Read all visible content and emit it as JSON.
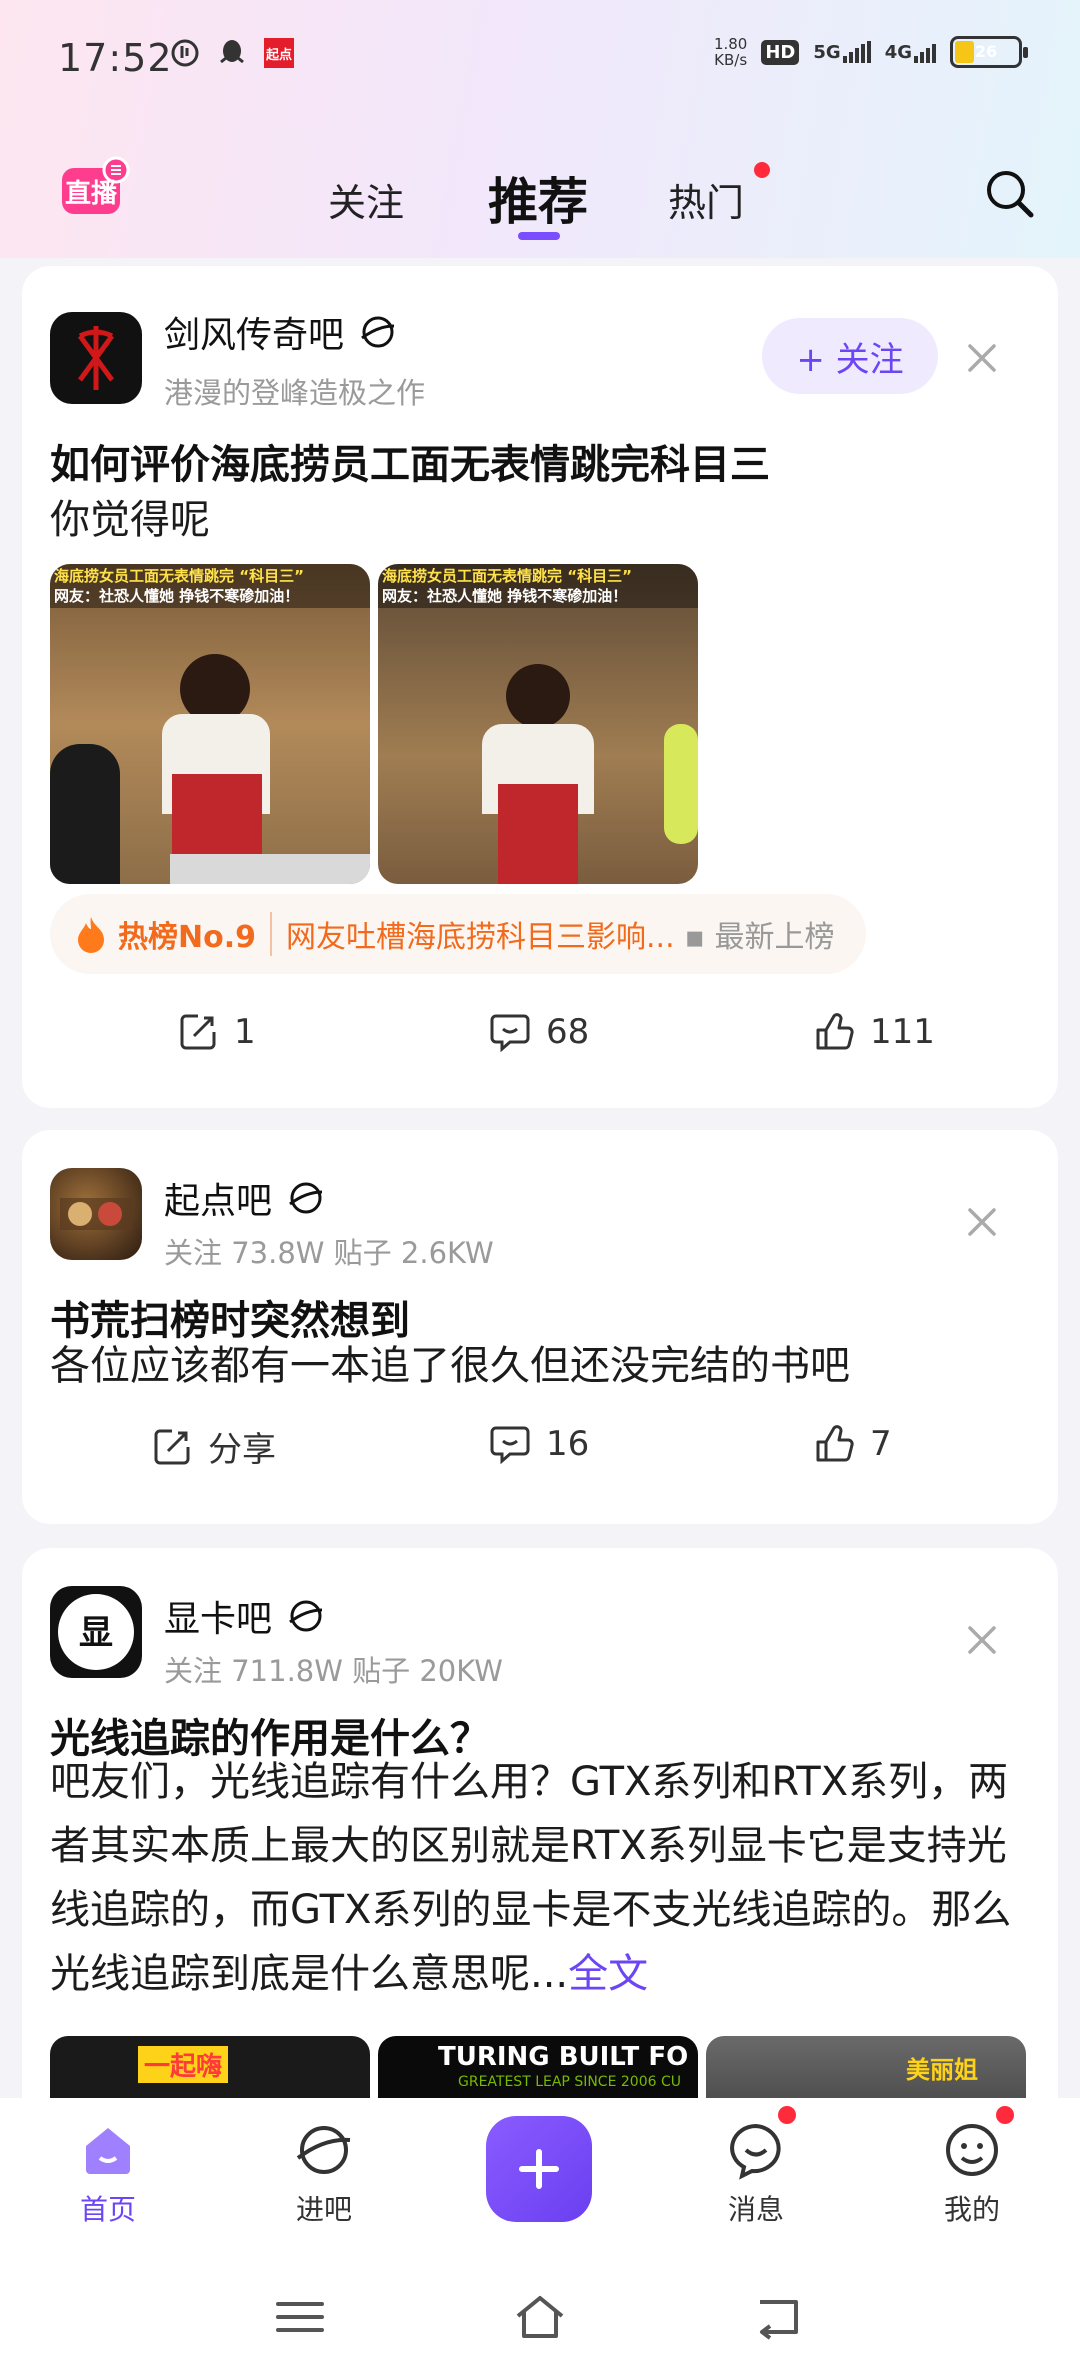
{
  "status_bar": {
    "time": "17:52",
    "net_speed_value": "1.80",
    "net_speed_unit": "KB/s",
    "hd_label": "HD",
    "sim1": "5G",
    "sim2": "4G",
    "battery": "26",
    "app_badge": "起点"
  },
  "top_nav": {
    "tabs": [
      {
        "label": "关注"
      },
      {
        "label": "推荐"
      },
      {
        "label": "热门"
      }
    ],
    "active_tab": "推荐",
    "live_icon": "live-tv-icon",
    "live_text": "直播",
    "accent_color": "#7a4dff",
    "red_dot_color": "#ff2b3c"
  },
  "feed": [
    {
      "bar_name": "剑风传奇吧",
      "bar_subtitle": "港漫的登峰造极之作",
      "follow_label": "+ 关注",
      "title": "如何评价海底捞员工面无表情跳完科目三",
      "body": "你觉得呢",
      "image_caption_1": "海底捞女员工面无表情跳完 “科目三”",
      "image_caption_2": "网友：社恐人懂她 挣钱不寒碜加油！",
      "hot_rank": "热榜No.9",
      "hot_text": "网友吐槽海底捞科目三影响...",
      "hot_new": "最新上榜",
      "repost": "1",
      "comments": "68",
      "likes": "111"
    },
    {
      "bar_name": "起点吧",
      "bar_subtitle": "关注 73.8W   贴子 2.6KW",
      "title": "书荒扫榜时突然想到",
      "body": "各位应该都有一本追了很久但还没完结的书吧",
      "repost": "分享",
      "comments": "16",
      "likes": "7"
    },
    {
      "bar_name": "显卡吧",
      "bar_subtitle": "关注 711.8W   贴子 20KW",
      "title": "光线追踪的作用是什么？",
      "body": "吧友们，光线追踪有什么用？GTX系列和RTX系列，两者其实本质上最大的区别就是RTX系列显卡它是支持光线追踪的，而GTX系列的显卡是不支光线追踪的。那么光线追踪到底是什么意思呢...",
      "more_label": "全文",
      "img1_text": "一起嗨",
      "img2_text": "TURING BUILT FO",
      "img2_sub": "GREATEST LEAP SINCE 2006 CU",
      "img3_text": "美丽姐"
    }
  ],
  "bottom_nav": [
    {
      "label": "首页",
      "icon": "home-icon"
    },
    {
      "label": "进吧",
      "icon": "planet-icon"
    },
    {
      "label": "",
      "icon": "plus-icon"
    },
    {
      "label": "消息",
      "icon": "message-icon"
    },
    {
      "label": "我的",
      "icon": "profile-icon"
    }
  ]
}
